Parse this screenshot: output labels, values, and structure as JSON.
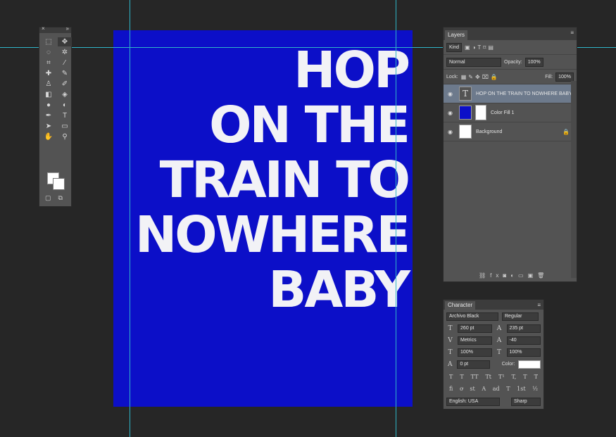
{
  "canvas": {
    "background": "#0c0fc8",
    "headline_lines": [
      "HOP",
      "ON THE",
      "TRAIN TO",
      "NOWHERE",
      "BABY"
    ]
  },
  "tools_panel": {
    "tools": [
      "marquee",
      "move",
      "lasso",
      "magic-wand",
      "crop",
      "eyedropper",
      "healing",
      "brush",
      "stamp",
      "history-brush",
      "eraser",
      "paint-bucket",
      "blur",
      "dodge",
      "pen",
      "T",
      "path-select",
      "shape",
      "hand",
      "zoom"
    ]
  },
  "layers_panel": {
    "tab": "Layers",
    "filter_kind": "Kind",
    "blend_mode": "Normal",
    "opacity_label": "Opacity:",
    "opacity_value": "100%",
    "lock_label": "Lock:",
    "fill_label": "Fill:",
    "fill_value": "100%",
    "layers": [
      {
        "name": "HOP ON THE TRAIN TO NOWHERE BABY",
        "type": "text",
        "selected": true
      },
      {
        "name": "Color Fill 1",
        "type": "fill",
        "color": "#0c0fc8"
      },
      {
        "name": "Background",
        "type": "background",
        "locked": true
      }
    ],
    "footer_icons": [
      "link",
      "fx",
      "mask",
      "adjustment",
      "group",
      "new-layer",
      "trash"
    ]
  },
  "character_panel": {
    "tab": "Character",
    "font_family": "Archivo Black",
    "font_style": "Regular",
    "font_size": "260 pt",
    "leading": "235 pt",
    "kerning": "Metrics",
    "tracking": "-40",
    "vertical_scale": "100%",
    "horizontal_scale": "100%",
    "baseline_shift": "0 pt",
    "color_label": "Color:",
    "color_value": "#ffffff",
    "language": "English: USA",
    "antialias": "Sharp",
    "style_buttons": [
      "T",
      "T",
      "TT",
      "Tt",
      "T¹",
      "T,",
      "T",
      "T"
    ],
    "opentype_buttons": [
      "fi",
      "ơ",
      "st",
      "A",
      "ad",
      "T",
      "1st",
      "½"
    ]
  }
}
